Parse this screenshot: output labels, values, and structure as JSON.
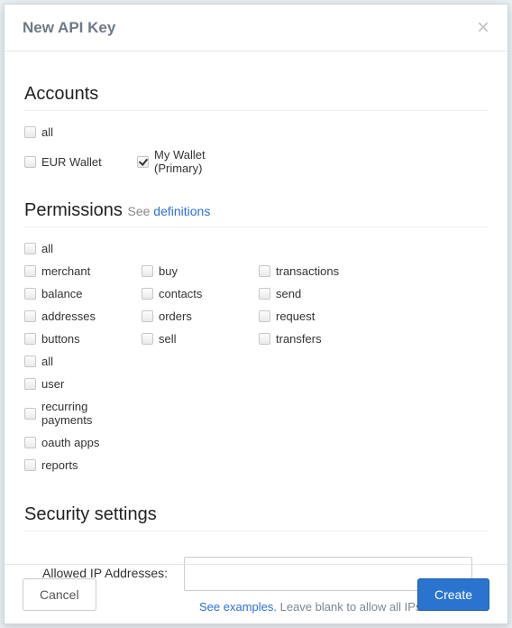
{
  "header": {
    "title": "New API Key"
  },
  "sections": {
    "accounts_title": "Accounts",
    "permissions_title": "Permissions",
    "permissions_sub_prefix": "See ",
    "permissions_sub_link": "definitions",
    "security_title": "Security settings"
  },
  "accounts": {
    "all_label": "all",
    "items": [
      {
        "label": "EUR Wallet",
        "checked": false
      },
      {
        "label": "My Wallet (Primary)",
        "checked": true
      }
    ]
  },
  "permissions": {
    "all_label": "all",
    "columns": [
      [
        "merchant",
        "balance",
        "addresses",
        "buttons",
        "all"
      ],
      [
        "buy",
        "contacts",
        "orders",
        "sell"
      ],
      [
        "transactions",
        "send",
        "request",
        "transfers"
      ],
      [
        "user",
        "recurring payments",
        "oauth apps",
        "reports"
      ]
    ]
  },
  "security": {
    "ip_label": "Allowed IP Addresses:",
    "ip_value": "",
    "hint_link": "See examples.",
    "hint_rest": " Leave blank to allow all IPs."
  },
  "footer": {
    "cancel": "Cancel",
    "create": "Create"
  }
}
